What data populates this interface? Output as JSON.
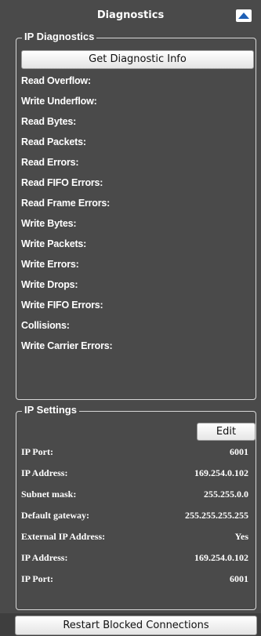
{
  "header": {
    "title": "Diagnostics",
    "collapse_icon": "triangle-up-icon"
  },
  "ip_diagnostics": {
    "legend": "IP Diagnostics",
    "button_label": "Get Diagnostic Info",
    "items": [
      "Read Overflow:",
      "Write Underflow:",
      "Read Bytes:",
      "Read Packets:",
      "Read Errors:",
      "Read FIFO Errors:",
      "Read Frame Errors:",
      "Write Bytes:",
      "Write Packets:",
      "Write Errors:",
      "Write Drops:",
      "Write FIFO Errors:",
      "Collisions:",
      "Write Carrier Errors:"
    ]
  },
  "ip_settings": {
    "legend": "IP Settings",
    "edit_label": "Edit",
    "rows": [
      {
        "label": "IP Port:",
        "value": "6001"
      },
      {
        "label": "IP Address:",
        "value": "169.254.0.102"
      },
      {
        "label": "Subnet mask:",
        "value": "255.255.0.0"
      },
      {
        "label": "Default gateway:",
        "value": "255.255.255.255"
      },
      {
        "label": "External IP Address:",
        "value": "Yes"
      },
      {
        "label": "IP Address:",
        "value": "169.254.0.102"
      },
      {
        "label": "IP Port:",
        "value": "6001"
      }
    ]
  },
  "footer": {
    "restart_label": "Restart Blocked Connections"
  }
}
